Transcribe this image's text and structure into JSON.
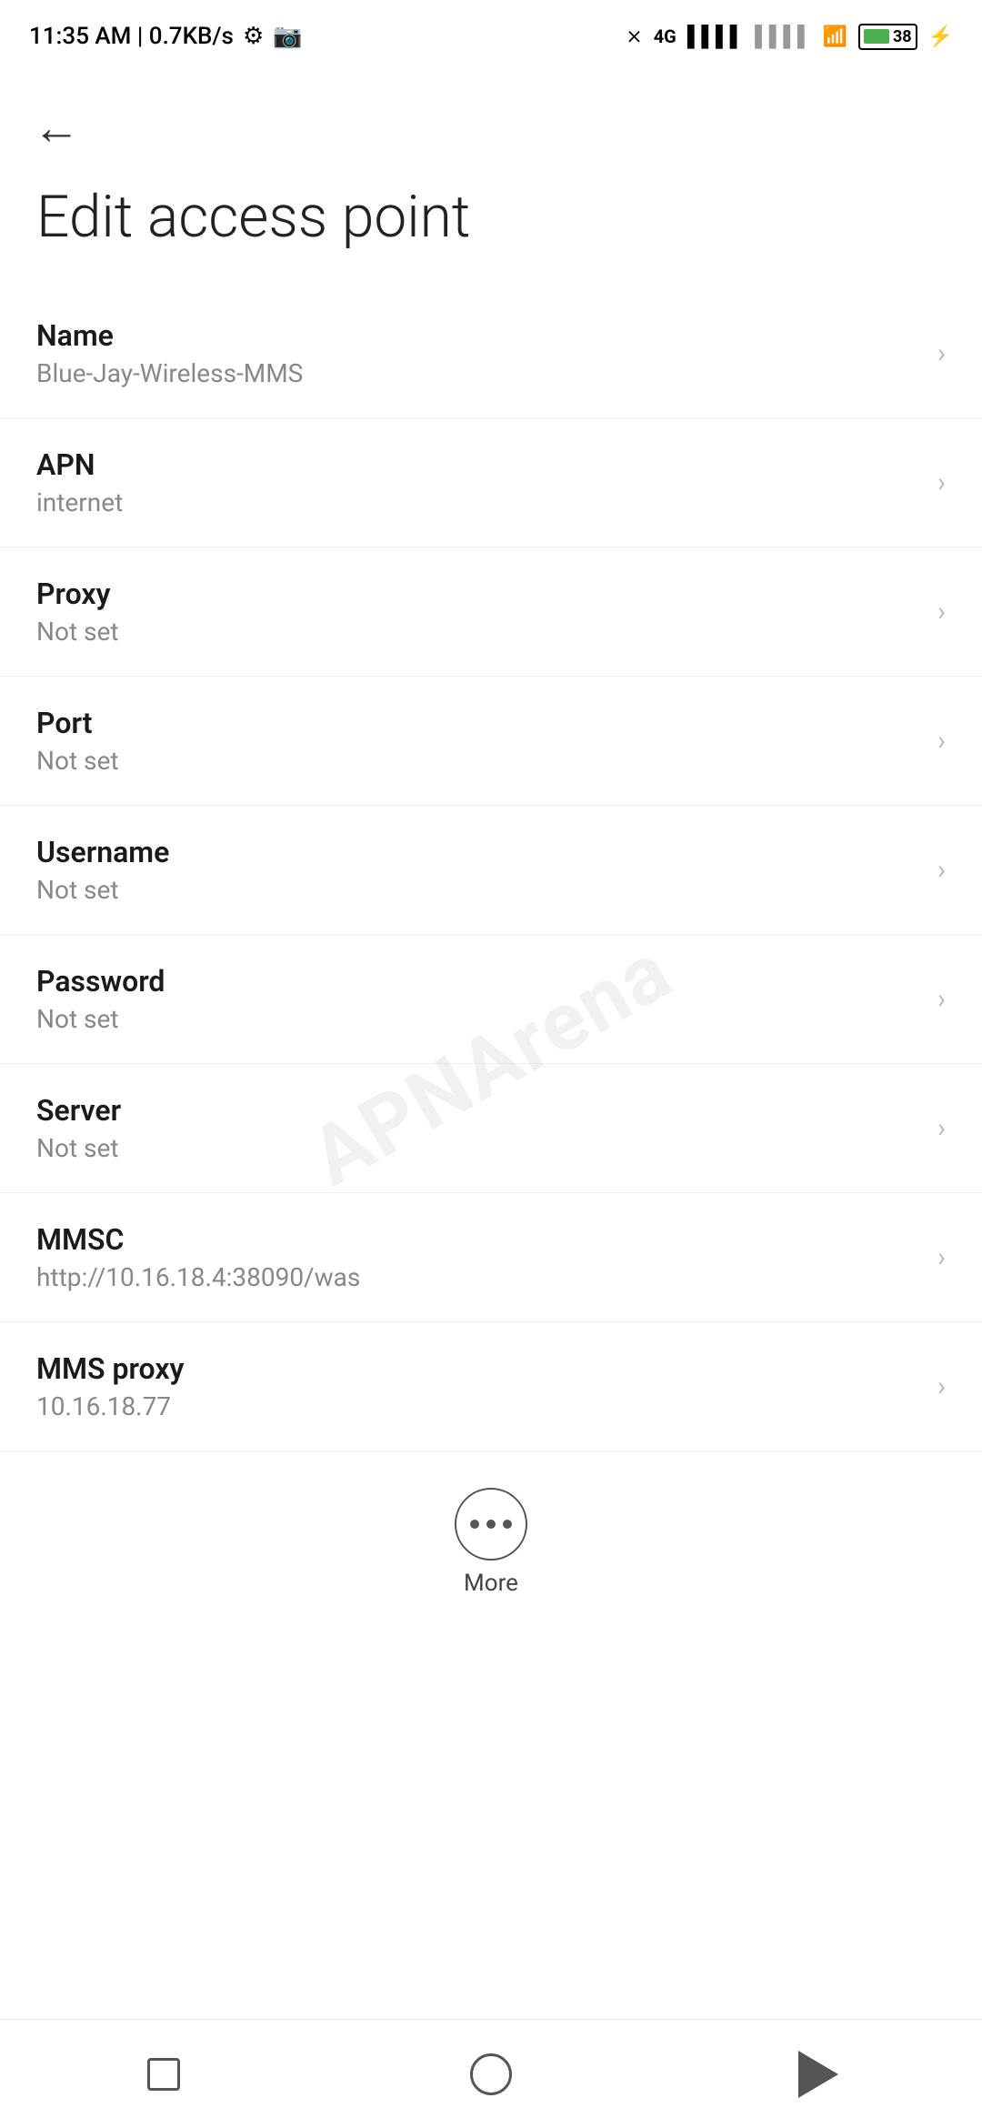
{
  "statusBar": {
    "time": "11:35 AM | 0.7KB/s",
    "battery": "38"
  },
  "page": {
    "title": "Edit access point",
    "backLabel": "Back"
  },
  "items": [
    {
      "label": "Name",
      "value": "Blue-Jay-Wireless-MMS"
    },
    {
      "label": "APN",
      "value": "internet"
    },
    {
      "label": "Proxy",
      "value": "Not set"
    },
    {
      "label": "Port",
      "value": "Not set"
    },
    {
      "label": "Username",
      "value": "Not set"
    },
    {
      "label": "Password",
      "value": "Not set"
    },
    {
      "label": "Server",
      "value": "Not set"
    },
    {
      "label": "MMSC",
      "value": "http://10.16.18.4:38090/was"
    },
    {
      "label": "MMS proxy",
      "value": "10.16.18.77"
    }
  ],
  "more": {
    "label": "More"
  },
  "watermark": "APNArena"
}
